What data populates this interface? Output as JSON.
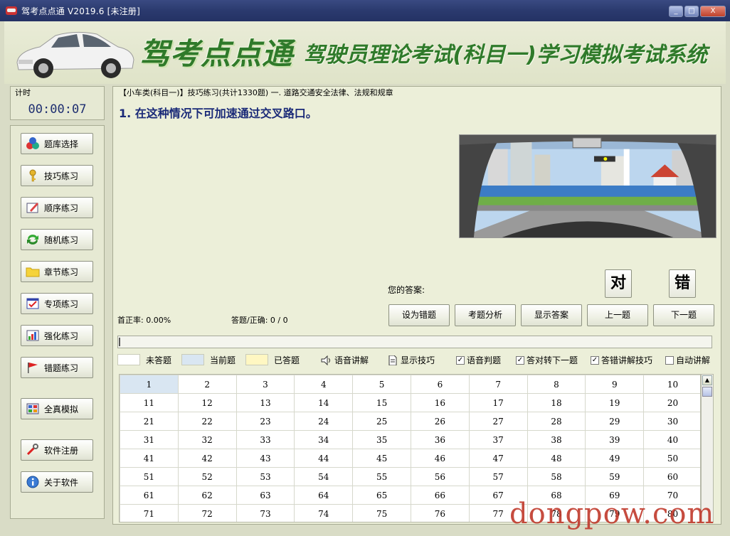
{
  "window": {
    "title": "驾考点点通  V2019.6 [未注册]",
    "buttons": {
      "minimize": "_",
      "maximize": "□",
      "close": "X"
    }
  },
  "header": {
    "brand": "驾考点点通",
    "subtitle": "— 驾驶员理论考试(科目一)学习模拟考试系统"
  },
  "timer": {
    "label": "计时",
    "value": "00:00:07"
  },
  "sidebar": {
    "items": [
      {
        "label": "题库选择",
        "icon": "molecule-icon"
      },
      {
        "label": "技巧练习",
        "icon": "key-icon"
      },
      {
        "label": "顺序练习",
        "icon": "edit-icon"
      },
      {
        "label": "随机练习",
        "icon": "refresh-icon"
      },
      {
        "label": "章节练习",
        "icon": "folder-icon"
      },
      {
        "label": "专项练习",
        "icon": "checklist-icon"
      },
      {
        "label": "强化练习",
        "icon": "chart-icon"
      },
      {
        "label": "错题练习",
        "icon": "flag-icon"
      },
      {
        "label": "全真模拟",
        "icon": "calculator-icon"
      },
      {
        "label": "软件注册",
        "icon": "tool-icon"
      },
      {
        "label": "关于软件",
        "icon": "info-icon"
      }
    ]
  },
  "main": {
    "breadcrumb": "【小车类(科目一)】技巧练习(共计1330题) 一. 道路交通安全法律、法规和规章",
    "question": "1. 在这种情况下可加速通过交叉路口。",
    "answer_label": "您的答案:",
    "judge": {
      "right": "对",
      "wrong": "错"
    },
    "accuracy": "首正率: 0.00%",
    "answered": "答题/正确: 0 / 0",
    "actions": [
      "设为错题",
      "考题分析",
      "显示答案",
      "上一题",
      "下一题"
    ],
    "progress": 0
  },
  "legend": {
    "unanswered": "未答题",
    "current": "当前题",
    "answered": "已答题",
    "voice_explain": "语音讲解",
    "show_tips": "显示技巧"
  },
  "options": [
    {
      "label": "语音判题",
      "checked": true
    },
    {
      "label": "答对转下一题",
      "checked": true
    },
    {
      "label": "答错讲解技巧",
      "checked": true
    },
    {
      "label": "自动讲解",
      "checked": false
    }
  ],
  "grid": {
    "rows": [
      [
        "1",
        "2",
        "3",
        "4",
        "5",
        "6",
        "7",
        "8",
        "9",
        "10"
      ],
      [
        "11",
        "12",
        "13",
        "14",
        "15",
        "16",
        "17",
        "18",
        "19",
        "20"
      ],
      [
        "21",
        "22",
        "23",
        "24",
        "25",
        "26",
        "27",
        "28",
        "29",
        "30"
      ],
      [
        "31",
        "32",
        "33",
        "34",
        "35",
        "36",
        "37",
        "38",
        "39",
        "40"
      ],
      [
        "41",
        "42",
        "43",
        "44",
        "45",
        "46",
        "47",
        "48",
        "49",
        "50"
      ],
      [
        "51",
        "52",
        "53",
        "54",
        "55",
        "56",
        "57",
        "58",
        "59",
        "60"
      ],
      [
        "61",
        "62",
        "63",
        "64",
        "65",
        "66",
        "67",
        "68",
        "69",
        "70"
      ],
      [
        "71",
        "72",
        "73",
        "74",
        "75",
        "76",
        "77",
        "78",
        "79",
        "80"
      ]
    ],
    "current": "1"
  },
  "watermark": "dongpow.com",
  "colors": {
    "accent": "#2f7a2a",
    "question": "#1a2a78",
    "current_cell": "#d9e6f2",
    "answered_swatch": "#fff7c2"
  }
}
